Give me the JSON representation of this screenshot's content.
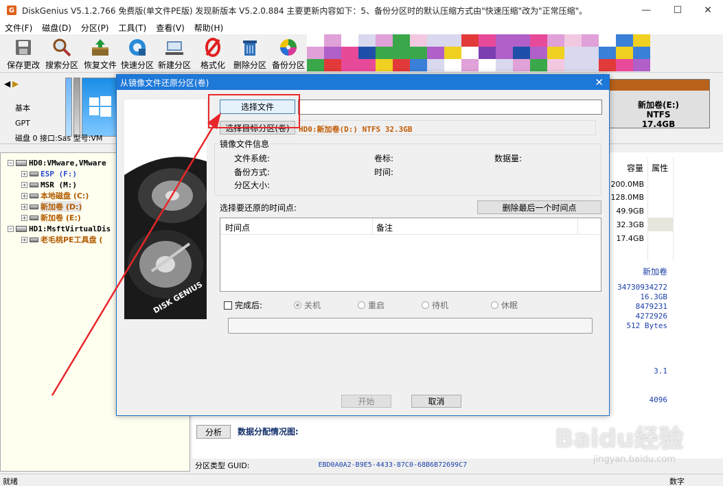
{
  "window": {
    "title": "DiskGenius V5.1.2.766 免费版(单文件PE版)   发现新版本 V5.2.0.884 主要更新内容如下：5、备份分区时的默认压缩方式由\"快速压缩\"改为\"正常压缩\"。",
    "icon_letter": "G",
    "minimize": "—",
    "maximize": "☐",
    "close": "✕"
  },
  "menu": [
    "文件(F)",
    "磁盘(D)",
    "分区(P)",
    "工具(T)",
    "查看(V)",
    "帮助(H)"
  ],
  "toolbar": [
    {
      "label": "保存更改",
      "icon": "save-icon"
    },
    {
      "label": "搜索分区",
      "icon": "magnifier-icon"
    },
    {
      "label": "恢复文件",
      "icon": "restore-box-icon"
    },
    {
      "label": "快速分区",
      "icon": "quick-partition-icon"
    },
    {
      "label": "新建分区",
      "icon": "new-partition-icon"
    },
    {
      "label": "格式化",
      "icon": "format-icon"
    },
    {
      "label": "删除分区",
      "icon": "trash-icon"
    },
    {
      "label": "备份分区",
      "icon": "backup-disc-icon"
    }
  ],
  "disk_side": {
    "type1": "基本",
    "type2": "GPT",
    "info": "磁盘 0 接口:Sas  型号:VM"
  },
  "disk_e": {
    "name": "新加卷(E:)",
    "fs": "NTFS",
    "size": "17.4GB"
  },
  "tree": [
    {
      "label": "HD0:VMware,VMware",
      "level": 0,
      "color": "#000000"
    },
    {
      "label": "ESP (F:)",
      "level": 1,
      "color": "#2a4ad0"
    },
    {
      "label": "MSR (M:)",
      "level": 1,
      "color": "#000000"
    },
    {
      "label": "本地磁盘 (C:)",
      "level": 1,
      "color": "#b15b00"
    },
    {
      "label": "新加卷 (D:)",
      "level": 1,
      "color": "#b15b00"
    },
    {
      "label": "新加卷 (E:)",
      "level": 1,
      "color": "#b15b00"
    },
    {
      "label": "HD1:MsftVirtualDis",
      "level": 0,
      "color": "#000000"
    },
    {
      "label": "老毛桃PE工具盘 (",
      "level": 1,
      "color": "#b15b00"
    }
  ],
  "table": {
    "headers": {
      "capacity": "容量",
      "attribute": "属性"
    },
    "capacities": [
      "200.0MB",
      "128.0MB",
      "49.9GB",
      "32.3GB",
      "17.4GB"
    ]
  },
  "details": {
    "volume_name": "新加卷",
    "values": [
      "34730934272",
      "16.3GB",
      "8479231",
      "4272926",
      "512 Bytes"
    ],
    "version": "3.1",
    "cluster": "4096"
  },
  "analyze": {
    "button": "分析",
    "label": "数据分配情况图:"
  },
  "guid": {
    "label": "分区类型 GUID:",
    "value": "EBD0A0A2-B9E5-4433-87C0-68B6B72699C7"
  },
  "status": {
    "left": "就绪",
    "right": "数字"
  },
  "dialog": {
    "title": "从镜像文件还原分区(卷)",
    "close": "✕",
    "choose_file": "选择文件",
    "file_path": "",
    "choose_target": "选择目标分区(卷)",
    "target_value": "HD0:新加卷(D:) NTFS 32.3GB",
    "image_info_title": "镜像文件信息",
    "fs_label": "文件系统:",
    "volume_label": "卷标:",
    "data_amount_label": "数据量:",
    "backup_mode_label": "备份方式:",
    "time_label": "时间:",
    "partition_size_label": "分区大小:",
    "restore_point_label": "选择要还原的时间点:",
    "delete_last_button": "删除最后一个时间点",
    "list_headers": {
      "time": "时间点",
      "note": "备注"
    },
    "after_done_label": "完成后:",
    "radios": [
      {
        "label": "关机",
        "selected": true
      },
      {
        "label": "重启",
        "selected": false
      },
      {
        "label": "待机",
        "selected": false
      },
      {
        "label": "休眠",
        "selected": false
      }
    ],
    "start_button": "开始",
    "cancel_button": "取消",
    "image_text": "DISK GENIUS"
  },
  "watermark": {
    "main": "Baidu经验",
    "sub": "jingyan.baidu.com"
  },
  "colors": {
    "accent": "#1d78d8",
    "highlight": "#e8262a",
    "title_text": "#222222"
  }
}
